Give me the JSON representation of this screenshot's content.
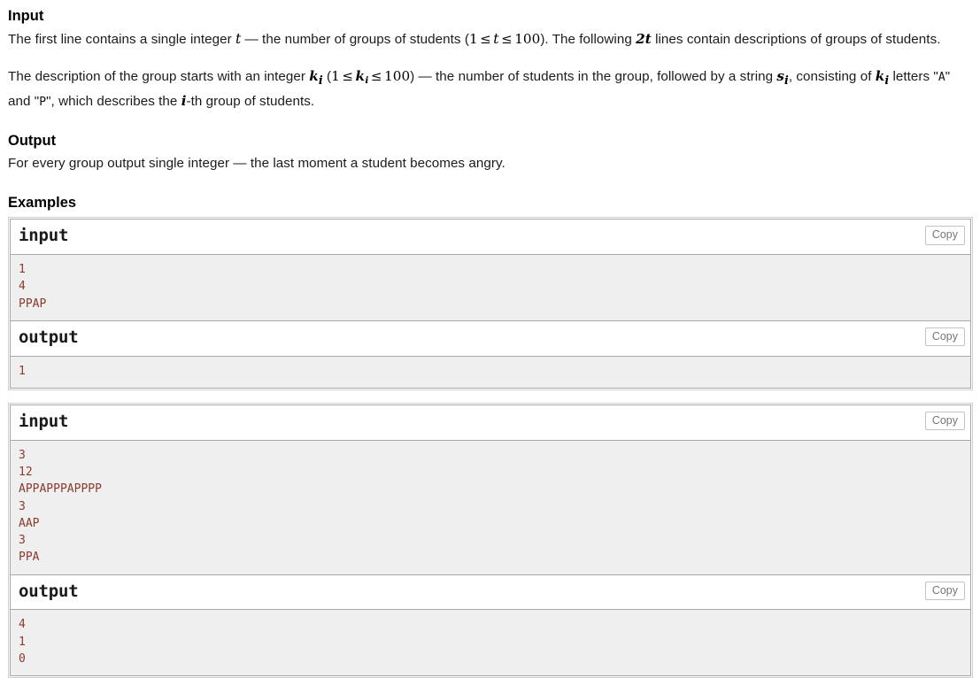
{
  "sections": {
    "input": {
      "heading": "Input",
      "paragraph1": {
        "part1": "The first line contains a single integer ",
        "math_t": "t",
        "part2": " — the number of groups of students (",
        "math_range_1": "1",
        "math_le_1": "≤",
        "math_var_t": "t",
        "math_le_2": "≤",
        "math_range_100": "100",
        "part3": "). The following ",
        "math_2t": "2t",
        "part4": " lines contain descriptions of groups of students."
      },
      "paragraph2": {
        "part1": "The description of the group starts with an integer ",
        "math_k": "k",
        "math_k_sub": "i",
        "part2": " (",
        "math_one": "1",
        "math_le_1": "≤",
        "math_k2": "k",
        "math_k2_sub": "i",
        "math_le_2": "≤",
        "math_hundred": "100",
        "part3": ") — the number of students in the group, followed by a string ",
        "math_s": "s",
        "math_s_sub": "i",
        "part4": ", consisting of ",
        "math_k3": "k",
        "math_k3_sub": "i",
        "part5": " letters \"",
        "code_a": "A",
        "part6": "\" and \"",
        "code_p": "P",
        "part7": "\", which describes the ",
        "math_i": "i",
        "part8": "-th group of students."
      }
    },
    "output": {
      "heading": "Output",
      "paragraph": "For every group output single integer — the last moment a student becomes angry."
    },
    "examples": {
      "heading": "Examples",
      "copy_label": "Copy",
      "tests": [
        {
          "input_label": "input",
          "input_text": "1\n4\nPPAP",
          "output_label": "output",
          "output_text": "1"
        },
        {
          "input_label": "input",
          "input_text": "3\n12\nAPPAPPPAPPPP\n3\nAAP\n3\nPPA",
          "output_label": "output",
          "output_text": "4\n1\n0"
        }
      ]
    }
  },
  "colors": {
    "sample_text": "#8c3a2e",
    "sample_bg": "#efefef",
    "border": "#a8a8a8",
    "copy_text": "#777777"
  }
}
